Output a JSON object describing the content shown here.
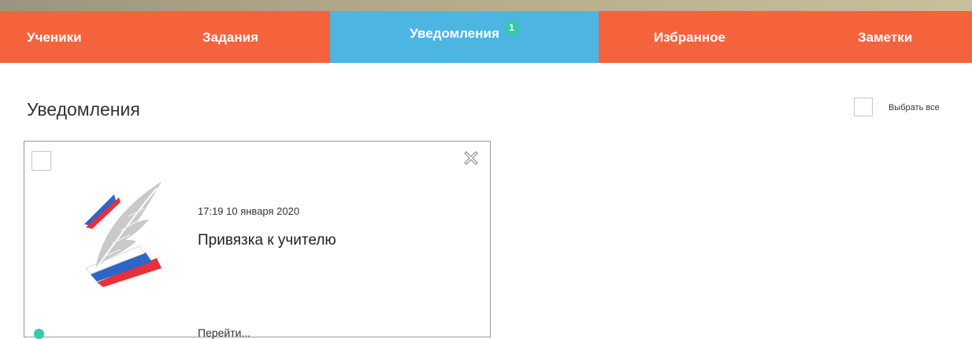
{
  "nav": {
    "tabs": [
      {
        "label": "Ученики"
      },
      {
        "label": "Задания"
      },
      {
        "label": "Уведомления",
        "badge": "1"
      },
      {
        "label": "Избранное"
      },
      {
        "label": "Заметки"
      }
    ],
    "active_tab": "Уведомления"
  },
  "page": {
    "title": "Уведомления",
    "select_all_label": "Выбрать все"
  },
  "notification": {
    "datetime": "17:19 10 января 2020",
    "title": "Привязка к учителю",
    "link": "Перейти...",
    "unread": true,
    "logo_icon": "quill-book-logo"
  },
  "colors": {
    "nav_bg": "#f5633c",
    "nav_active_bg": "#4db5e2",
    "badge_bg": "#36c9a8",
    "status_dot": "#36c9b0"
  }
}
